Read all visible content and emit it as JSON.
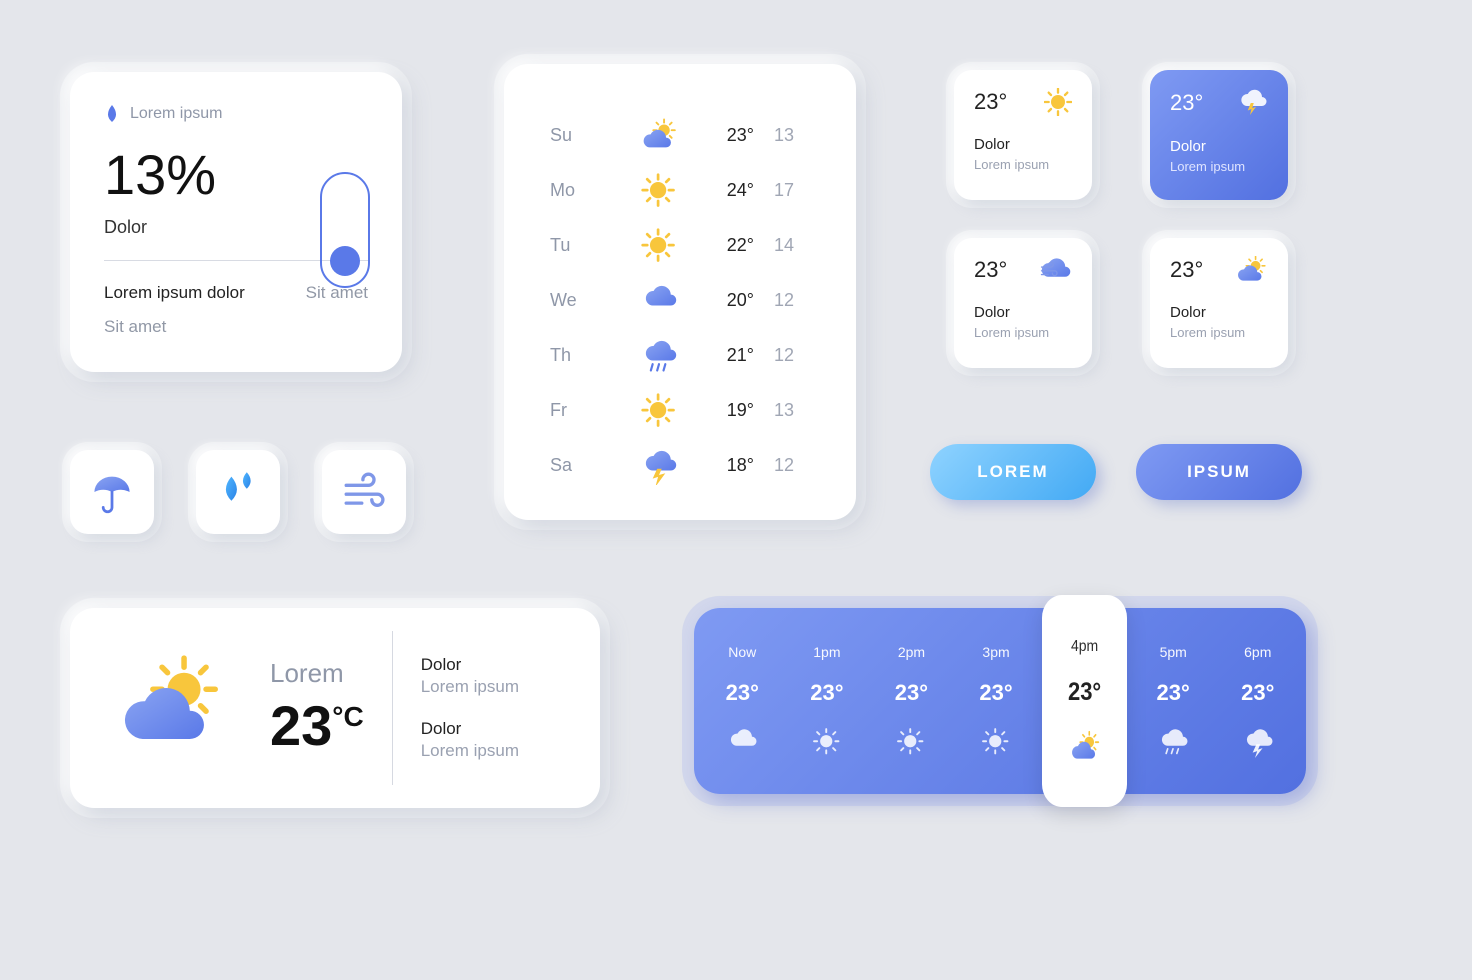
{
  "humidity": {
    "label": "Lorem ipsum",
    "value": "13%",
    "sub": "Dolor",
    "line1_left": "Lorem ipsum dolor",
    "line1_right": "Sit amet",
    "line2": "Sit amet"
  },
  "iconButtons": [
    "umbrella",
    "drops",
    "wind"
  ],
  "weekly": [
    {
      "day": "Su",
      "icon": "partly",
      "hi": "23°",
      "lo": "13"
    },
    {
      "day": "Mo",
      "icon": "sun",
      "hi": "24°",
      "lo": "17"
    },
    {
      "day": "Tu",
      "icon": "sun",
      "hi": "22°",
      "lo": "14"
    },
    {
      "day": "We",
      "icon": "cloud",
      "hi": "20°",
      "lo": "12"
    },
    {
      "day": "Th",
      "icon": "rain",
      "hi": "21°",
      "lo": "12"
    },
    {
      "day": "Fr",
      "icon": "sun",
      "hi": "19°",
      "lo": "13"
    },
    {
      "day": "Sa",
      "icon": "storm",
      "hi": "18°",
      "lo": "12"
    }
  ],
  "miniCards": [
    {
      "temp": "23°",
      "icon": "sun",
      "title": "Dolor",
      "sub": "Lorem ipsum"
    },
    {
      "temp": "23°",
      "icon": "storm-white",
      "title": "Dolor",
      "sub": "Lorem ipsum"
    },
    {
      "temp": "23°",
      "icon": "wind-cloud",
      "title": "Dolor",
      "sub": "Lorem ipsum"
    },
    {
      "temp": "23°",
      "icon": "partly",
      "title": "Dolor",
      "sub": "Lorem ipsum"
    }
  ],
  "pills": {
    "a": "LOREM",
    "b": "IPSUM"
  },
  "current": {
    "location": "Lorem",
    "temp": "23",
    "unit": "°C",
    "side": [
      {
        "h": "Dolor",
        "s": "Lorem ipsum"
      },
      {
        "h": "Dolor",
        "s": "Lorem ipsum"
      }
    ]
  },
  "hourly": [
    {
      "time": "Now",
      "temp": "23°",
      "icon": "cloud-w"
    },
    {
      "time": "1pm",
      "temp": "23°",
      "icon": "sun-w"
    },
    {
      "time": "2pm",
      "temp": "23°",
      "icon": "sun-w"
    },
    {
      "time": "3pm",
      "temp": "23°",
      "icon": "sun-w"
    },
    {
      "time": "4pm",
      "temp": "23°",
      "icon": "partly",
      "selected": true
    },
    {
      "time": "5pm",
      "temp": "23°",
      "icon": "rain-w"
    },
    {
      "time": "6pm",
      "temp": "23°",
      "icon": "storm-w"
    }
  ]
}
